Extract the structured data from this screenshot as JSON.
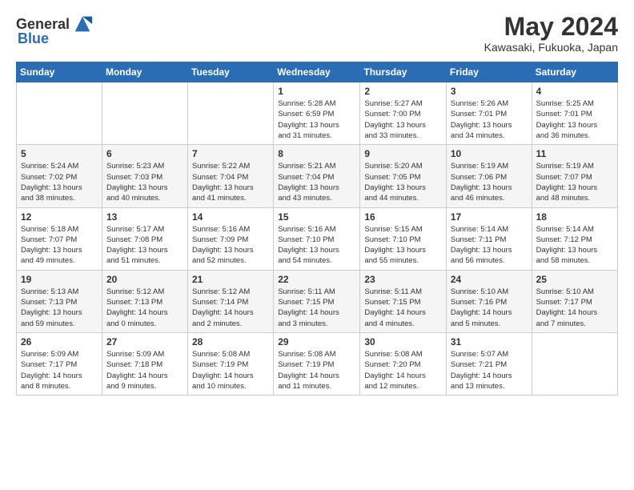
{
  "header": {
    "logo_general": "General",
    "logo_blue": "Blue",
    "month_year": "May 2024",
    "location": "Kawasaki, Fukuoka, Japan"
  },
  "weekdays": [
    "Sunday",
    "Monday",
    "Tuesday",
    "Wednesday",
    "Thursday",
    "Friday",
    "Saturday"
  ],
  "weeks": [
    [
      {
        "day": "",
        "info": ""
      },
      {
        "day": "",
        "info": ""
      },
      {
        "day": "",
        "info": ""
      },
      {
        "day": "1",
        "info": "Sunrise: 5:28 AM\nSunset: 6:59 PM\nDaylight: 13 hours\nand 31 minutes."
      },
      {
        "day": "2",
        "info": "Sunrise: 5:27 AM\nSunset: 7:00 PM\nDaylight: 13 hours\nand 33 minutes."
      },
      {
        "day": "3",
        "info": "Sunrise: 5:26 AM\nSunset: 7:01 PM\nDaylight: 13 hours\nand 34 minutes."
      },
      {
        "day": "4",
        "info": "Sunrise: 5:25 AM\nSunset: 7:01 PM\nDaylight: 13 hours\nand 36 minutes."
      }
    ],
    [
      {
        "day": "5",
        "info": "Sunrise: 5:24 AM\nSunset: 7:02 PM\nDaylight: 13 hours\nand 38 minutes."
      },
      {
        "day": "6",
        "info": "Sunrise: 5:23 AM\nSunset: 7:03 PM\nDaylight: 13 hours\nand 40 minutes."
      },
      {
        "day": "7",
        "info": "Sunrise: 5:22 AM\nSunset: 7:04 PM\nDaylight: 13 hours\nand 41 minutes."
      },
      {
        "day": "8",
        "info": "Sunrise: 5:21 AM\nSunset: 7:04 PM\nDaylight: 13 hours\nand 43 minutes."
      },
      {
        "day": "9",
        "info": "Sunrise: 5:20 AM\nSunset: 7:05 PM\nDaylight: 13 hours\nand 44 minutes."
      },
      {
        "day": "10",
        "info": "Sunrise: 5:19 AM\nSunset: 7:06 PM\nDaylight: 13 hours\nand 46 minutes."
      },
      {
        "day": "11",
        "info": "Sunrise: 5:19 AM\nSunset: 7:07 PM\nDaylight: 13 hours\nand 48 minutes."
      }
    ],
    [
      {
        "day": "12",
        "info": "Sunrise: 5:18 AM\nSunset: 7:07 PM\nDaylight: 13 hours\nand 49 minutes."
      },
      {
        "day": "13",
        "info": "Sunrise: 5:17 AM\nSunset: 7:08 PM\nDaylight: 13 hours\nand 51 minutes."
      },
      {
        "day": "14",
        "info": "Sunrise: 5:16 AM\nSunset: 7:09 PM\nDaylight: 13 hours\nand 52 minutes."
      },
      {
        "day": "15",
        "info": "Sunrise: 5:16 AM\nSunset: 7:10 PM\nDaylight: 13 hours\nand 54 minutes."
      },
      {
        "day": "16",
        "info": "Sunrise: 5:15 AM\nSunset: 7:10 PM\nDaylight: 13 hours\nand 55 minutes."
      },
      {
        "day": "17",
        "info": "Sunrise: 5:14 AM\nSunset: 7:11 PM\nDaylight: 13 hours\nand 56 minutes."
      },
      {
        "day": "18",
        "info": "Sunrise: 5:14 AM\nSunset: 7:12 PM\nDaylight: 13 hours\nand 58 minutes."
      }
    ],
    [
      {
        "day": "19",
        "info": "Sunrise: 5:13 AM\nSunset: 7:13 PM\nDaylight: 13 hours\nand 59 minutes."
      },
      {
        "day": "20",
        "info": "Sunrise: 5:12 AM\nSunset: 7:13 PM\nDaylight: 14 hours\nand 0 minutes."
      },
      {
        "day": "21",
        "info": "Sunrise: 5:12 AM\nSunset: 7:14 PM\nDaylight: 14 hours\nand 2 minutes."
      },
      {
        "day": "22",
        "info": "Sunrise: 5:11 AM\nSunset: 7:15 PM\nDaylight: 14 hours\nand 3 minutes."
      },
      {
        "day": "23",
        "info": "Sunrise: 5:11 AM\nSunset: 7:15 PM\nDaylight: 14 hours\nand 4 minutes."
      },
      {
        "day": "24",
        "info": "Sunrise: 5:10 AM\nSunset: 7:16 PM\nDaylight: 14 hours\nand 5 minutes."
      },
      {
        "day": "25",
        "info": "Sunrise: 5:10 AM\nSunset: 7:17 PM\nDaylight: 14 hours\nand 7 minutes."
      }
    ],
    [
      {
        "day": "26",
        "info": "Sunrise: 5:09 AM\nSunset: 7:17 PM\nDaylight: 14 hours\nand 8 minutes."
      },
      {
        "day": "27",
        "info": "Sunrise: 5:09 AM\nSunset: 7:18 PM\nDaylight: 14 hours\nand 9 minutes."
      },
      {
        "day": "28",
        "info": "Sunrise: 5:08 AM\nSunset: 7:19 PM\nDaylight: 14 hours\nand 10 minutes."
      },
      {
        "day": "29",
        "info": "Sunrise: 5:08 AM\nSunset: 7:19 PM\nDaylight: 14 hours\nand 11 minutes."
      },
      {
        "day": "30",
        "info": "Sunrise: 5:08 AM\nSunset: 7:20 PM\nDaylight: 14 hours\nand 12 minutes."
      },
      {
        "day": "31",
        "info": "Sunrise: 5:07 AM\nSunset: 7:21 PM\nDaylight: 14 hours\nand 13 minutes."
      },
      {
        "day": "",
        "info": ""
      }
    ]
  ]
}
